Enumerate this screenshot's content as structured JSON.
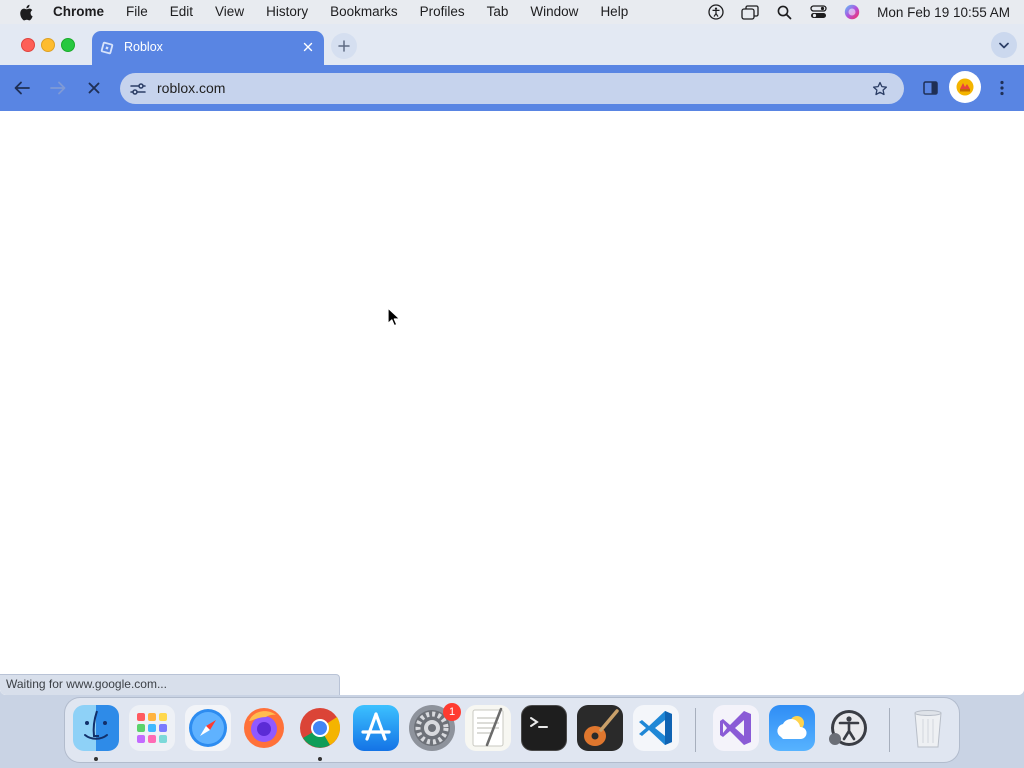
{
  "menubar": {
    "apple_icon": "apple-logo",
    "app_name": "Chrome",
    "items": [
      "File",
      "Edit",
      "View",
      "History",
      "Bookmarks",
      "Profiles",
      "Tab",
      "Window",
      "Help"
    ],
    "status_icons": [
      "accessibility-icon",
      "window-switcher-icon",
      "spotlight-icon",
      "control-center-icon",
      "siri-icon"
    ],
    "clock": "Mon Feb 19  10:55 AM"
  },
  "browser": {
    "tab": {
      "title": "Roblox",
      "favicon": "roblox-favicon"
    },
    "toolbar": {
      "back_icon": "back-arrow-icon",
      "forward_icon": "forward-arrow-icon",
      "stop_icon": "stop-loading-icon",
      "url": "roblox.com",
      "site_info_icon": "site-info-icon",
      "bookmark_icon": "star-icon",
      "side_panel_icon": "side-panel-icon",
      "menu_icon": "kebab-menu-icon"
    },
    "status_text": "Waiting for www.google.com...",
    "accent_color": "#5985e3"
  },
  "dock": {
    "apps": [
      {
        "name": "Finder",
        "running": true
      },
      {
        "name": "Launchpad",
        "running": false
      },
      {
        "name": "Safari",
        "running": false
      },
      {
        "name": "Firefox",
        "running": false
      },
      {
        "name": "Google Chrome",
        "running": true
      },
      {
        "name": "App Store",
        "running": false
      },
      {
        "name": "System Settings",
        "running": false,
        "badge": "1"
      },
      {
        "name": "TextEdit",
        "running": false
      },
      {
        "name": "Terminal",
        "running": false
      },
      {
        "name": "GarageBand",
        "running": false
      },
      {
        "name": "Visual Studio Code",
        "running": false
      },
      {
        "name": "Visual Studio",
        "running": false
      },
      {
        "name": "Weather",
        "running": false
      },
      {
        "name": "Accessibility Inspector",
        "running": false
      },
      {
        "name": "Trash",
        "running": false
      }
    ]
  }
}
